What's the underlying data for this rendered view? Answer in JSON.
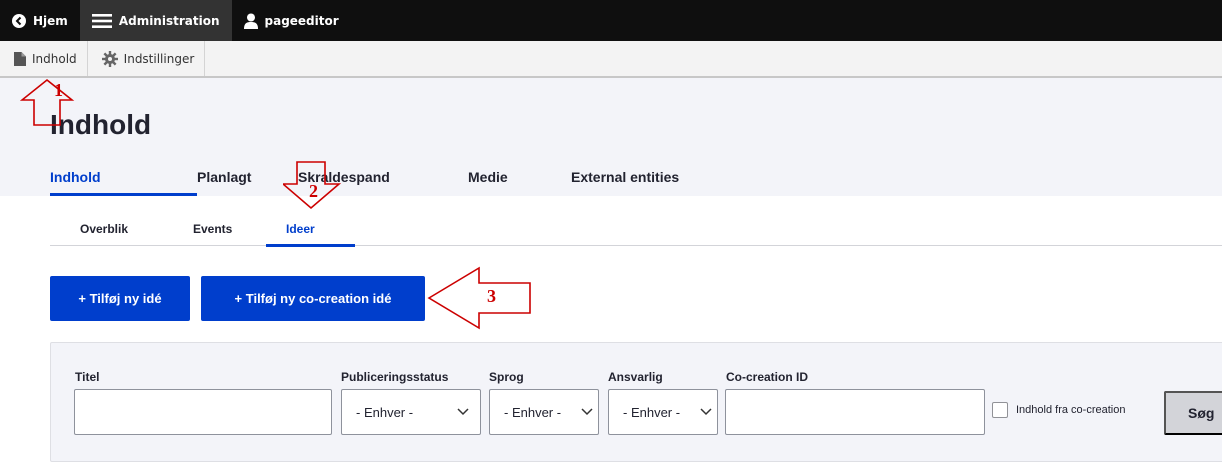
{
  "toolbar": {
    "home_label": "Hjem",
    "admin_label": "Administration",
    "user_label": "pageeditor"
  },
  "tray": {
    "content_label": "Indhold",
    "settings_label": "Indstillinger"
  },
  "page": {
    "title": "Indhold"
  },
  "primary_tabs": [
    {
      "label": "Indhold",
      "active": true
    },
    {
      "label": "Planlagt",
      "active": false
    },
    {
      "label": "Skraldespand",
      "active": false
    },
    {
      "label": "Medie",
      "active": false
    },
    {
      "label": "External entities",
      "active": false
    }
  ],
  "secondary_tabs": [
    {
      "label": "Overblik",
      "active": false
    },
    {
      "label": "Events",
      "active": false
    },
    {
      "label": "Ideer",
      "active": true
    }
  ],
  "actions": {
    "add_idea": "+ Tilføj ny idé",
    "add_cocreation_idea": "+ Tilføj ny co-creation idé"
  },
  "filters": {
    "title_label": "Titel",
    "title_value": "",
    "status_label": "Publiceringsstatus",
    "status_value": "- Enhver -",
    "language_label": "Sprog",
    "language_value": "- Enhver -",
    "responsible_label": "Ansvarlig",
    "responsible_value": "- Enhver -",
    "cocreation_id_label": "Co-creation ID",
    "cocreation_id_value": "",
    "cocreation_checkbox_label": "Indhold fra co-creation",
    "search_button": "Søg"
  },
  "annotations": [
    "1",
    "2",
    "3"
  ],
  "colors": {
    "toolbar_bg": "#0f0f0f",
    "accent": "#003ecc",
    "annotation_red": "#cc0000"
  }
}
